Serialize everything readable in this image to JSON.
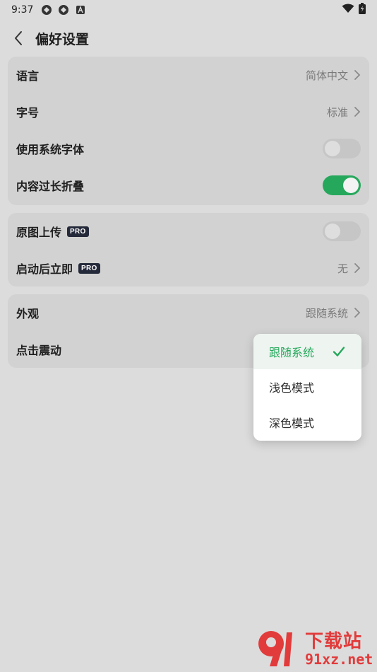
{
  "status_bar": {
    "time": "9:37",
    "icons": [
      "app-icon",
      "app-icon",
      "notification-icon"
    ],
    "right_icons": [
      "wifi-icon",
      "battery-icon"
    ]
  },
  "header": {
    "back_icon": "chevron-left-icon",
    "title": "偏好设置"
  },
  "group1": {
    "language": {
      "label": "语言",
      "value": "简体中文"
    },
    "font_size": {
      "label": "字号",
      "value": "标准"
    },
    "system_font": {
      "label": "使用系统字体",
      "enabled": false
    },
    "fold_long": {
      "label": "内容过长折叠",
      "enabled": true
    }
  },
  "group2": {
    "original_upload": {
      "label": "原图上传",
      "badge": "PRO",
      "enabled": false
    },
    "launch_after": {
      "label": "启动后立即",
      "badge": "PRO",
      "value": "无"
    }
  },
  "group3": {
    "appearance": {
      "label": "外观",
      "value": "跟随系统"
    },
    "click_vibration": {
      "label": "点击震动"
    }
  },
  "appearance_menu": {
    "options": [
      "跟随系统",
      "浅色模式",
      "深色模式"
    ],
    "selected": "跟随系统"
  },
  "watermark": {
    "brand": "下载站",
    "url": "91xz.net"
  },
  "colors": {
    "accent": "#26a85c",
    "background": "#dcdcdc",
    "card": "#d2d2d2",
    "badge": "#252a3b",
    "watermark": "#e23b3b"
  }
}
